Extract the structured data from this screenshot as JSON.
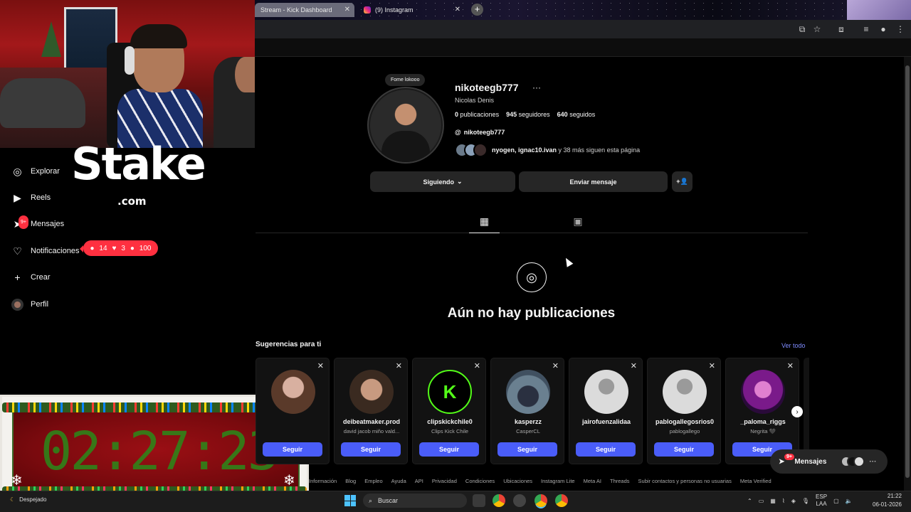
{
  "browser": {
    "tabs": [
      {
        "label": "Stream - Kick Dashboard"
      },
      {
        "label": "(9) Instagram"
      }
    ],
    "new_tab": "+"
  },
  "stream_overlay": {
    "logo": "Stake",
    "logo_sub": ".com",
    "timer": "02:27:23"
  },
  "sidebar": {
    "items": [
      {
        "label": "Explorar",
        "icon": "compass-icon"
      },
      {
        "label": "Reels",
        "icon": "reels-icon"
      },
      {
        "label": "Mensajes",
        "icon": "messenger-icon",
        "badge": "9+"
      },
      {
        "label": "Notificaciones",
        "icon": "heart-icon"
      },
      {
        "label": "Crear",
        "icon": "plus-icon"
      },
      {
        "label": "Perfil",
        "icon": "avatar-icon"
      }
    ],
    "notif_pill": {
      "comments": "14",
      "likes": "3",
      "follows": "100"
    }
  },
  "profile": {
    "note": "Fome lokooo",
    "username": "nikoteegb777",
    "full_name": "Nicolas Denis",
    "posts_count": "0",
    "posts_label": "publicaciones",
    "followers_count": "945",
    "followers_label": "seguidores",
    "following_count": "640",
    "following_label": "seguidos",
    "threads_handle": "nikoteegb777",
    "followed_by_names": "nyogen, ignac10.ivan",
    "followed_by_rest": "y 38 más siguen esta página",
    "btn_following": "Siguiendo",
    "btn_message": "Enviar mensaje",
    "empty_title": "Aún no hay publicaciones"
  },
  "suggestions": {
    "title": "Sugerencias para ti",
    "see_all": "Ver todo",
    "follow_label": "Seguir",
    "cards": [
      {
        "username": "",
        "sub": ""
      },
      {
        "username": "deibeatmaker.prod",
        "sub": "david jacob miño vald..."
      },
      {
        "username": "clipskickchile0",
        "sub": "Clips Kick Chile"
      },
      {
        "username": "kasperzz",
        "sub": "CasperCL"
      },
      {
        "username": "jairofuenzalidaa",
        "sub": ""
      },
      {
        "username": "pablogallegosrios0",
        "sub": "pablogallego"
      },
      {
        "username": "_paloma_riggs",
        "sub": "Negrita 🖤"
      }
    ]
  },
  "messages_bubble": {
    "label": "Mensajes",
    "badge": "9+"
  },
  "footer": {
    "links": [
      "Información",
      "Blog",
      "Empleo",
      "Ayuda",
      "API",
      "Privacidad",
      "Condiciones",
      "Ubicaciones",
      "Instagram Lite",
      "Meta AI",
      "Threads",
      "Subir contactos y personas no usuarias",
      "Meta Verified"
    ]
  },
  "taskbar": {
    "weather": "Despejado",
    "search_placeholder": "Buscar",
    "lang_top": "ESP",
    "lang_bottom": "LAA",
    "time": "21:22",
    "date": "06-01-2026"
  },
  "colors": {
    "accent": "#4a5df9",
    "notification": "#ff3040",
    "link": "#7f8cff"
  }
}
